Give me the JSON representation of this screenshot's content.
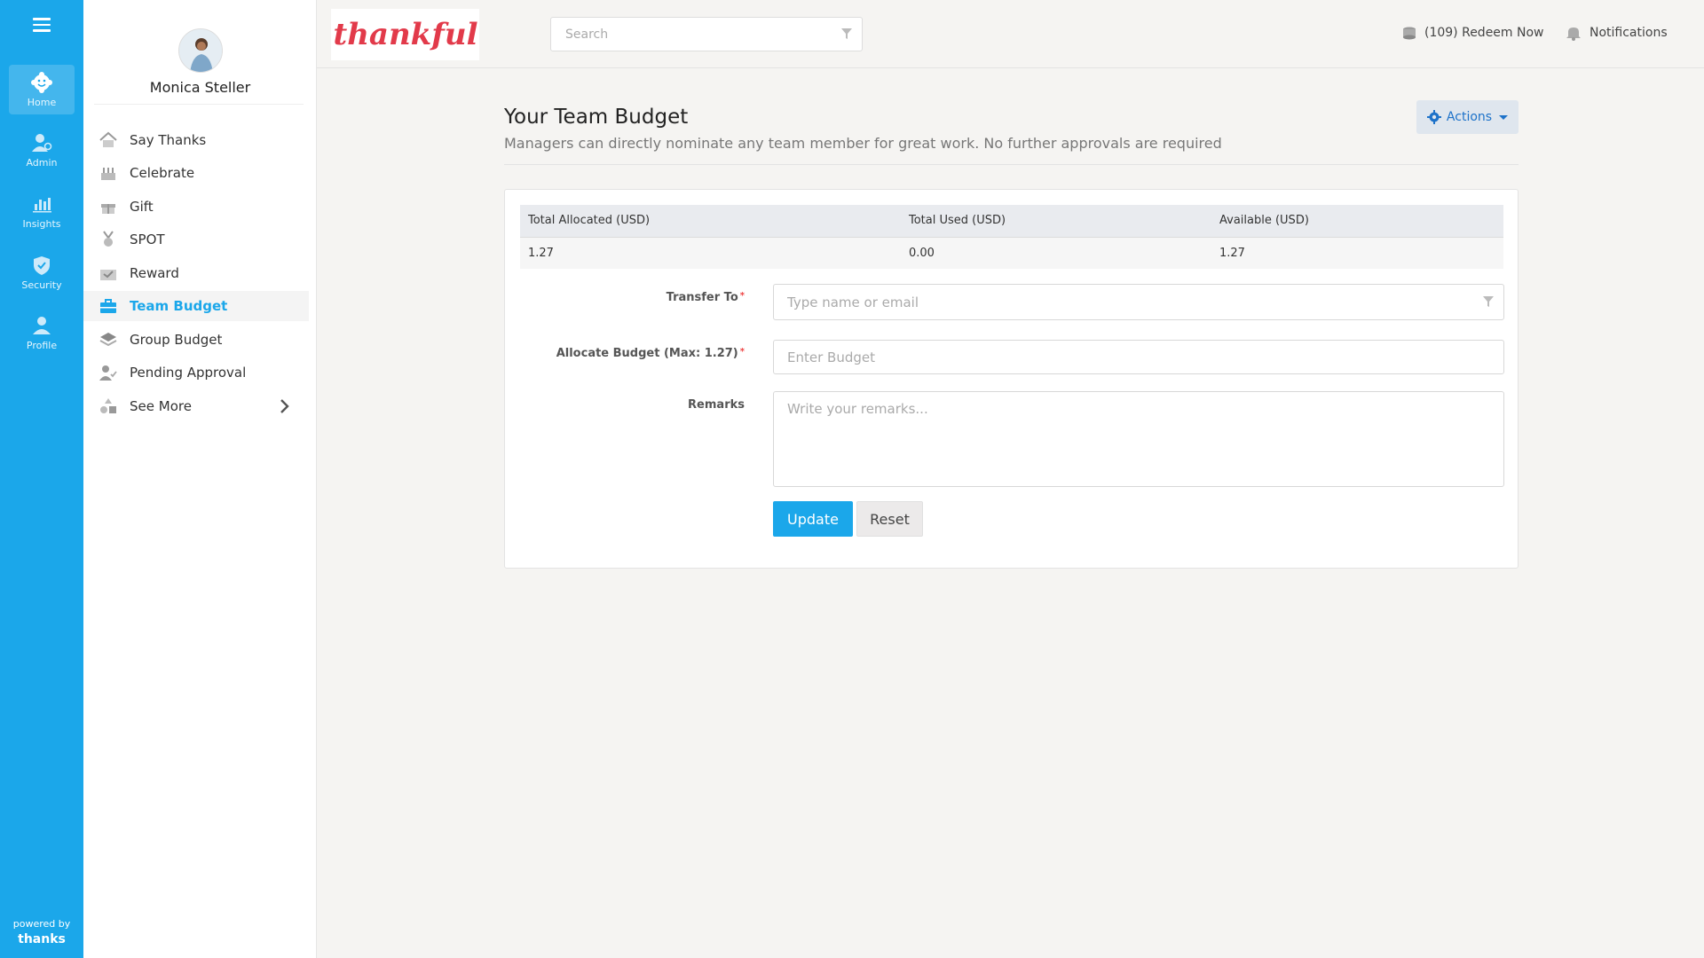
{
  "rail": {
    "items": [
      {
        "label": "Home",
        "icon": "home-icon"
      },
      {
        "label": "Admin",
        "icon": "admin-icon"
      },
      {
        "label": "Insights",
        "icon": "insights-icon"
      },
      {
        "label": "Security",
        "icon": "shield-icon"
      },
      {
        "label": "Profile",
        "icon": "profile-icon"
      }
    ],
    "powered_by": "powered by",
    "brand": "thanks"
  },
  "user": {
    "name": "Monica Steller"
  },
  "sidebar": {
    "items": [
      {
        "label": "Say Thanks",
        "icon": "house-icon"
      },
      {
        "label": "Celebrate",
        "icon": "cake-icon"
      },
      {
        "label": "Gift",
        "icon": "gift-icon"
      },
      {
        "label": "SPOT",
        "icon": "medal-icon"
      },
      {
        "label": "Reward",
        "icon": "reward-icon"
      },
      {
        "label": "Team Budget",
        "icon": "briefcase-icon",
        "active": true
      },
      {
        "label": "Group Budget",
        "icon": "layers-icon"
      },
      {
        "label": "Pending Approval",
        "icon": "user-check-icon"
      },
      {
        "label": "See More",
        "icon": "shapes-icon"
      }
    ]
  },
  "header": {
    "logo_text": "thankful",
    "search_placeholder": "Search",
    "redeem_label": "(109) Redeem Now",
    "notifications_label": "Notifications"
  },
  "page": {
    "title": "Your Team Budget",
    "subtitle": "Managers can directly nominate any team member for great work. No further approvals are required",
    "actions_label": "Actions"
  },
  "budget_table": {
    "headers": [
      "Total Allocated (USD)",
      "Total Used (USD)",
      "Available (USD)"
    ],
    "row": [
      "1.27",
      "0.00",
      "1.27"
    ]
  },
  "form": {
    "transfer_label": "Transfer To",
    "transfer_placeholder": "Type name or email",
    "allocate_label": "Allocate Budget (Max: 1.27)",
    "allocate_placeholder": "Enter Budget",
    "remarks_label": "Remarks",
    "remarks_placeholder": "Write your remarks...",
    "required_mark": "*",
    "update_label": "Update",
    "reset_label": "Reset"
  },
  "colors": {
    "accent": "#1ba7ea",
    "logo": "#e23a4a"
  }
}
